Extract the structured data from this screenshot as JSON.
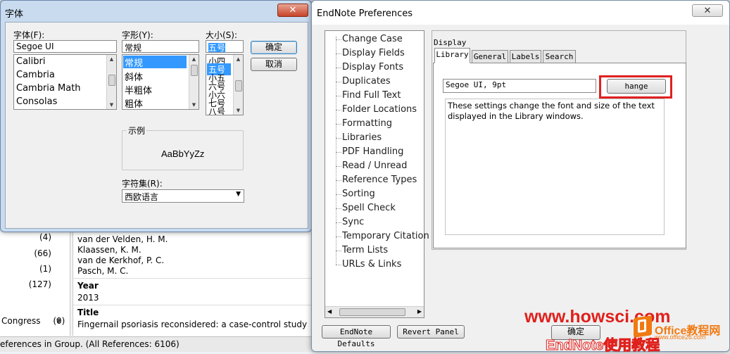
{
  "background_app": {
    "group_counts": [
      "(4)",
      "(66)",
      "(1)",
      "(127)"
    ],
    "group_congress_label": "Congress",
    "group_congress_count": "(0)",
    "authors": [
      "van der Velden, H. M.",
      "Klaassen, K. M.",
      "van de Kerkhof, P. C.",
      "Pasch, M. C."
    ],
    "year_label": "Year",
    "year_value": "2013",
    "title_label": "Title",
    "title_value": "Fingernail psoriasis reconsidered: a case-control study",
    "status_text": "eferences in Group. (All References: 6106)"
  },
  "font_dialog": {
    "title": "字体",
    "font_label": "字体(F):",
    "font_value": "Segoe UI",
    "fonts": [
      "Calibri",
      "Cambria",
      "Cambria Math",
      "Consolas"
    ],
    "style_label": "字形(Y):",
    "style_value": "常规",
    "styles": [
      "常规",
      "斜体",
      "半粗体",
      "粗体"
    ],
    "size_label": "大小(S):",
    "size_value": "五号",
    "sizes": [
      "小四",
      "五号",
      "小五",
      "六号",
      "小六",
      "七号",
      "八号"
    ],
    "ok_label": "确定",
    "cancel_label": "取消",
    "sample_label": "示例",
    "sample_text": "AaBbYyZz",
    "charset_label": "字符集(R):",
    "charset_value": "西欧语言"
  },
  "endnote_prefs": {
    "title": "EndNote Preferences",
    "nav_items": [
      "Change Case",
      "Display Fields",
      "Display Fonts",
      "Duplicates",
      "Find Full Text",
      "Folder Locations",
      "Formatting",
      "Libraries",
      "PDF Handling",
      "Read / Unread",
      "Reference Types",
      "Sorting",
      "Spell Check",
      "Sync",
      "Temporary Citation",
      "Term Lists",
      "URLs & Links"
    ],
    "selected_nav": "Display Fonts",
    "panel_title": "Display",
    "tabs": [
      "Library",
      "General",
      "Labels",
      "Search"
    ],
    "active_tab": "Library",
    "font_field_value": "Segoe UI, 9pt",
    "change_font_label": "hange Font...",
    "description": "These settings change the font and size of the text displayed in the Library windows.",
    "defaults_button": "EndNote Defaults",
    "revert_button": "Revert Panel",
    "ok_button": "确定"
  },
  "watermark": {
    "site_text": "www.howsci.com",
    "brand_text": "Office教程网",
    "brand_url": "www.office26.com",
    "footer_text": "EndNote使用教程",
    "color_red": "#e0201c",
    "color_orange": "#f07a12"
  }
}
